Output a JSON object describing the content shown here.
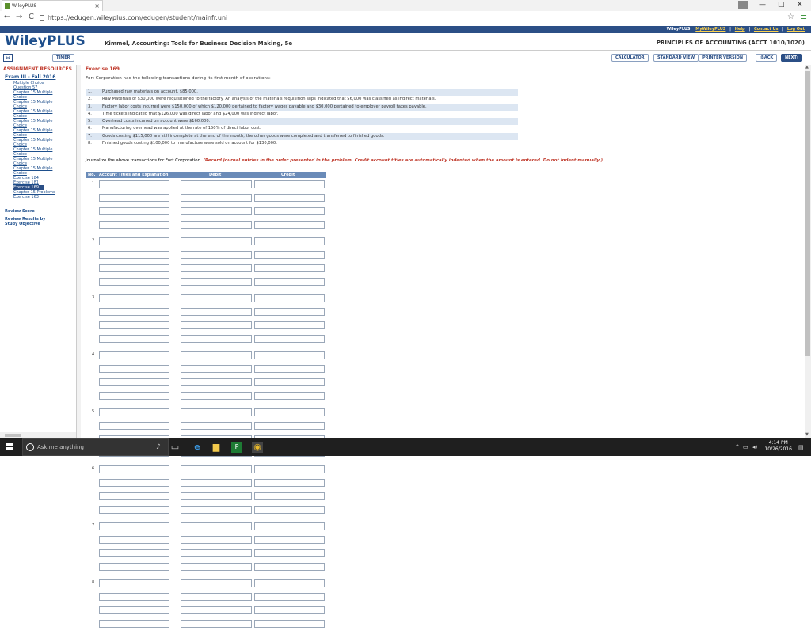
{
  "browser": {
    "tab_title": "WileyPLUS",
    "tab_close": "×",
    "url": "https://edugen.wileyplus.com/edugen/student/mainfr.uni",
    "back": "←",
    "forward": "→",
    "reload": "C",
    "minimize": "—",
    "maximize": "□",
    "close": "✕",
    "star": "☆",
    "menu": "≡"
  },
  "header": {
    "toplinks": [
      "WileyPLUS:",
      "MyWileyPLUS",
      "|",
      "Help",
      "|",
      "Contact Us",
      "|",
      "Log Out"
    ],
    "logo": "WileyPLUS",
    "course": "Kimmel, Accounting: Tools for Business Decision Making, 5e",
    "principles": "PRINCIPLES OF ACCOUNTING (ACCT 1010/1020)"
  },
  "toolbar": {
    "timer": "TIMER",
    "calculator": "CALCULATOR",
    "standard_view": "STANDARD VIEW",
    "printer_version": "PRINTER VERSION",
    "back": "‹BACK",
    "next": "NEXT›"
  },
  "sidebar": {
    "title": "ASSIGNMENT RESOURCES",
    "exam": "Exam III - Fall 2016",
    "items": [
      "Multiple Choice",
      "Question 57",
      "Chapter 15 Multiple",
      "Choice",
      "Chapter 15 Multiple",
      "Choice",
      "Chapter 15 Multiple",
      "Choice",
      "Chapter 15 Multiple",
      "Choice",
      "Chapter 15 Multiple",
      "Choice",
      "Chapter 15 Multiple",
      "Choice",
      "Chapter 15 Multiple",
      "Choice",
      "Chapter 15 Multiple",
      "Choice",
      "Chapter 15 Multiple",
      "Choice",
      "Exercise 184",
      "Exercise 181"
    ],
    "current": "Exercise 169",
    "after": [
      "Chapter 15 Problems",
      "Exercise 163"
    ],
    "review_score": "Review Score",
    "review_results": [
      "Review Results by",
      "Study Objective"
    ]
  },
  "exercise": {
    "title": "Exercise 169",
    "intro": "Fort Corporation had the following transactions during its first month of operations:",
    "transactions": [
      {
        "num": "1.",
        "text": "Purchased raw materials on account, $85,000."
      },
      {
        "num": "2.",
        "text": "Raw Materials of $30,000 were requisitioned to the factory. An analysis of the materials requisition slips indicated that $6,000 was classified as indirect materials."
      },
      {
        "num": "3.",
        "text": "Factory labor costs incurred were $150,000 of which $120,000 pertained to factory wages payable and $30,000 pertained to employer payroll taxes payable."
      },
      {
        "num": "4.",
        "text": "Time tickets indicated that $126,000 was direct labor and $24,000 was indirect labor."
      },
      {
        "num": "5.",
        "text": "Overhead costs incurred on account were $160,000."
      },
      {
        "num": "6.",
        "text": "Manufacturing overhead was applied at the rate of 150% of direct labor cost."
      },
      {
        "num": "7.",
        "text": "Goods costing $115,000 are still incomplete at the end of the month; the other goods were completed and transferred to finished goods."
      },
      {
        "num": "8.",
        "text": "Finished goods costing $100,000 to manufacture were sold on account for $130,000."
      }
    ],
    "instruction_plain": "Journalize the above transactions for Fort Corporation.",
    "instruction_red": "(Record journal entries in the order presented in the problem. Credit account titles are automatically indented when the amount is entered. Do not indent manually.)"
  },
  "journal": {
    "col_no": "No.",
    "col_account": "Account Titles and Explanation",
    "col_debit": "Debit",
    "col_credit": "Credit",
    "entries": [
      "1.",
      "2.",
      "3.",
      "4.",
      "5.",
      "6.",
      "7.",
      "8."
    ]
  },
  "taskbar": {
    "search_placeholder": "Ask me anything",
    "time": "4:14 PM",
    "date": "10/26/2016"
  }
}
